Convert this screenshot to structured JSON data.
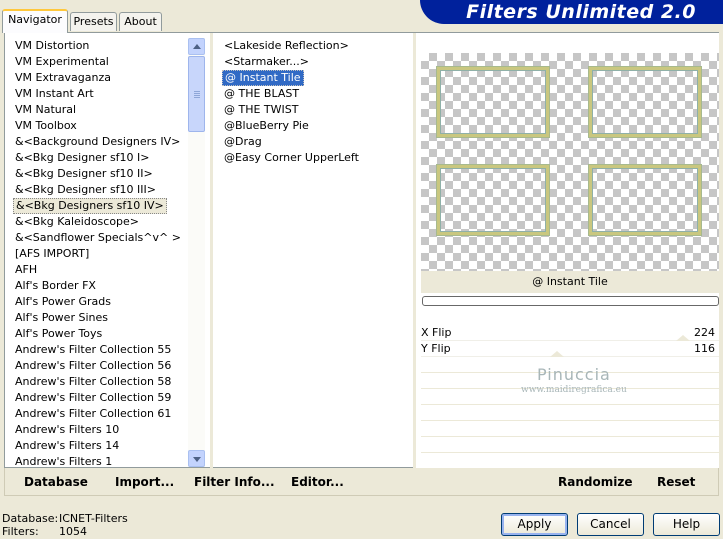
{
  "tabs": [
    {
      "label": "Navigator",
      "active": true
    },
    {
      "label": "Presets",
      "active": false
    },
    {
      "label": "About",
      "active": false
    }
  ],
  "brand_title": "Filters Unlimited 2.0",
  "categories": [
    "VM Distortion",
    "VM Experimental",
    "VM Extravaganza",
    "VM Instant Art",
    "VM Natural",
    "VM Toolbox",
    "&<Background Designers IV>",
    "&<Bkg Designer sf10 I>",
    "&<Bkg Designer sf10 II>",
    "&<Bkg Designer sf10 III>",
    "&<Bkg Designers sf10 IV>",
    "&<Bkg Kaleidoscope>",
    "&<Sandflower Specials^v^ >",
    "[AFS IMPORT]",
    "AFH",
    "Alf's Border FX",
    "Alf's Power Grads",
    "Alf's Power Sines",
    "Alf's Power Toys",
    "Andrew's Filter Collection 55",
    "Andrew's Filter Collection 56",
    "Andrew's Filter Collection 58",
    "Andrew's Filter Collection 59",
    "Andrew's Filter Collection 61",
    "Andrew's Filters 10",
    "Andrew's Filters 14",
    "Andrew's Filters 1"
  ],
  "selected_category": "&<Bkg Designers sf10 IV>",
  "filters": [
    "<Lakeside Reflection>",
    "<Starmaker...>",
    "@ Instant Tile",
    "@ THE BLAST",
    "@ THE TWIST",
    "@BlueBerry Pie",
    "@Drag",
    "@Easy Corner UpperLeft"
  ],
  "selected_filter": "@ Instant Tile",
  "preview_filter_name": "@ Instant Tile",
  "params": [
    {
      "label": "X Flip",
      "value": "224"
    },
    {
      "label": "Y Flip",
      "value": "116"
    }
  ],
  "watermark": {
    "name": "Pinuccia",
    "url": "www.maidiregrafica.eu"
  },
  "toolbar": {
    "database": "Database",
    "import": "Import...",
    "filter_info": "Filter Info...",
    "editor": "Editor...",
    "randomize": "Randomize",
    "reset": "Reset"
  },
  "status": {
    "database_label": "Database:",
    "database_value": "ICNET-Filters",
    "filters_label": "Filters:",
    "filters_value": "1054"
  },
  "buttons": {
    "apply": "Apply",
    "cancel": "Cancel",
    "help": "Help"
  },
  "colors": {
    "accent": "#316ac5",
    "brand_bar": "#00219c",
    "face": "#ece9d8"
  }
}
